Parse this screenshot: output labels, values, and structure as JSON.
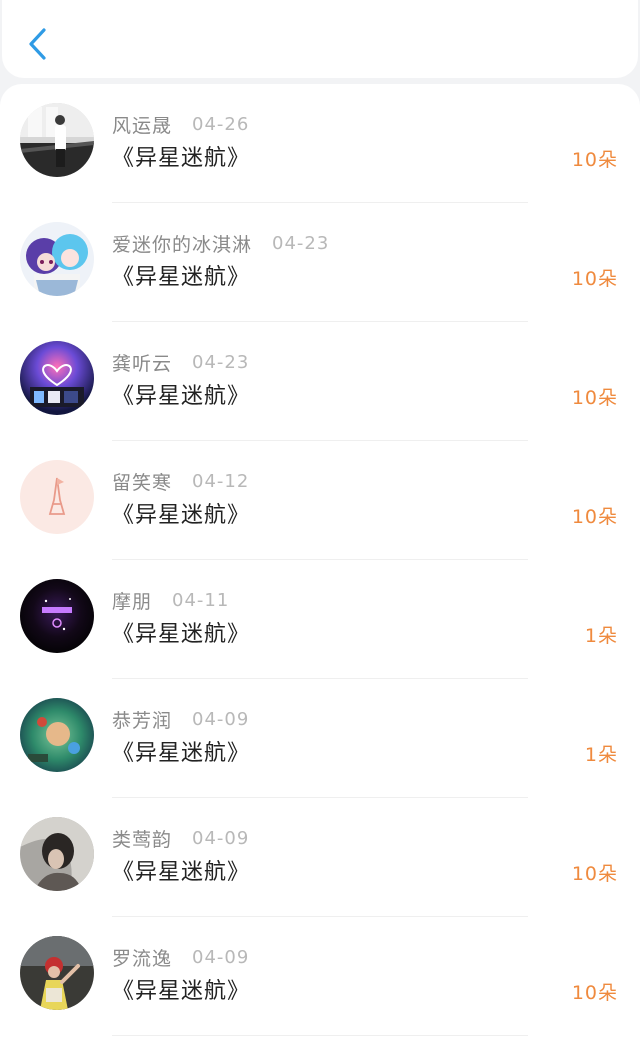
{
  "header": {
    "back_icon": "chevron-left-icon",
    "accent_color": "#2f9be5"
  },
  "colors": {
    "flower_count": "#ef8a3e",
    "name": "#8a8a8a",
    "date": "#b8b8b8",
    "title": "#222222"
  },
  "gifts": [
    {
      "name": "风运晟",
      "date": "04-26",
      "title": "《异星迷航》",
      "count": "10朵"
    },
    {
      "name": "爱迷你的冰淇淋",
      "date": "04-23",
      "title": "《异星迷航》",
      "count": "10朵"
    },
    {
      "name": "龚听云",
      "date": "04-23",
      "title": "《异星迷航》",
      "count": "10朵"
    },
    {
      "name": "留笑寒",
      "date": "04-12",
      "title": "《异星迷航》",
      "count": "10朵"
    },
    {
      "name": "摩朋",
      "date": "04-11",
      "title": "《异星迷航》",
      "count": "1朵"
    },
    {
      "name": "恭芳润",
      "date": "04-09",
      "title": "《异星迷航》",
      "count": "1朵"
    },
    {
      "name": "类莺韵",
      "date": "04-09",
      "title": "《异星迷航》",
      "count": "10朵"
    },
    {
      "name": "罗流逸",
      "date": "04-09",
      "title": "《异星迷航》",
      "count": "10朵"
    }
  ]
}
